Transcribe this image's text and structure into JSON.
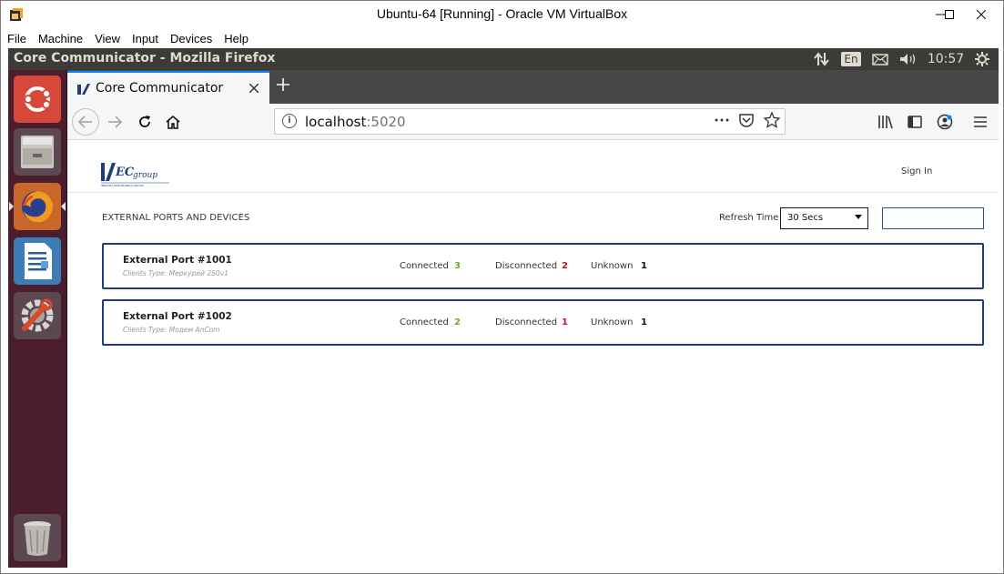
{
  "vbox": {
    "title": "Ubuntu-64 [Running] - Oracle VM VirtualBox",
    "menu": [
      "File",
      "Machine",
      "View",
      "Input",
      "Devices",
      "Help"
    ]
  },
  "ubuntu_panel": {
    "window_title": "Core Communicator - Mozilla Firefox",
    "language": "En",
    "clock": "10:57"
  },
  "launcher": {
    "items": [
      "ubuntu-dash-icon",
      "files-icon",
      "firefox-icon",
      "libreoffice-writer-icon",
      "system-settings-icon",
      "trash-icon"
    ]
  },
  "browser": {
    "tab_title": "Core Communicator",
    "url_host": "localhost",
    "url_port": ":5020"
  },
  "app": {
    "logo_text": "IEC group",
    "logo_subtext": "INKOTEX ELECTRONICS GROUP",
    "sign_in": "Sign In",
    "section_title": "EXTERNAL PORTS AND DEVICES",
    "refresh_label": "Refresh Time",
    "refresh_value": "30 Secs",
    "filter_value": "",
    "status_colors": {
      "connected": "#6fa82a",
      "disconnected": "#c0102a",
      "unknown": "#111111"
    },
    "ports": [
      {
        "name": "External Port #1001",
        "client_type": "Clients Type: Меркурий 250v1",
        "connected_label": "Connected",
        "connected": "3",
        "disconnected_label": "Disconnected",
        "disconnected": "2",
        "unknown_label": "Unknown",
        "unknown": "1"
      },
      {
        "name": "External Port #1002",
        "client_type": "Clients Type: Модем AnCom",
        "connected_label": "Connected",
        "connected": "2",
        "disconnected_label": "Disconnected",
        "disconnected": "1",
        "unknown_label": "Unknown",
        "unknown": "1"
      }
    ]
  }
}
